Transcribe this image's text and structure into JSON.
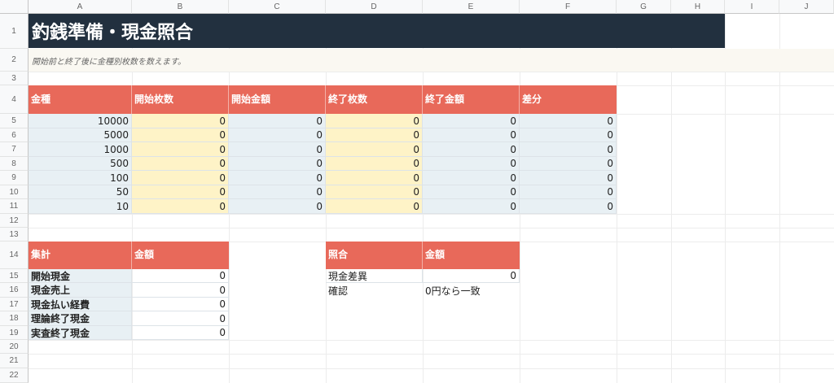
{
  "columns": [
    "A",
    "B",
    "C",
    "D",
    "E",
    "F",
    "G",
    "H",
    "I",
    "J"
  ],
  "rows": [
    "1",
    "2",
    "3",
    "4",
    "5",
    "6",
    "7",
    "8",
    "9",
    "10",
    "11",
    "12",
    "13",
    "14",
    "15",
    "16",
    "17",
    "18",
    "19",
    "20",
    "21",
    "22"
  ],
  "title": "釣銭準備・現金照合",
  "subtitle": "開始前と終了後に金種別枚数を数えます。",
  "denom_table": {
    "headers": [
      "金種",
      "開始枚数",
      "開始金額",
      "終了枚数",
      "終了金額",
      "差分"
    ],
    "rows": [
      [
        "10000",
        "0",
        "0",
        "0",
        "0",
        "0"
      ],
      [
        "5000",
        "0",
        "0",
        "0",
        "0",
        "0"
      ],
      [
        "1000",
        "0",
        "0",
        "0",
        "0",
        "0"
      ],
      [
        "500",
        "0",
        "0",
        "0",
        "0",
        "0"
      ],
      [
        "100",
        "0",
        "0",
        "0",
        "0",
        "0"
      ],
      [
        "50",
        "0",
        "0",
        "0",
        "0",
        "0"
      ],
      [
        "10",
        "0",
        "0",
        "0",
        "0",
        "0"
      ]
    ]
  },
  "summary_table": {
    "headers": [
      "集計",
      "金額"
    ],
    "rows": [
      [
        "開始現金",
        "0"
      ],
      [
        "現金売上",
        "0"
      ],
      [
        "現金払い経費",
        "0"
      ],
      [
        "理論終了現金",
        "0"
      ],
      [
        "実査終了現金",
        "0"
      ]
    ]
  },
  "check_table": {
    "headers": [
      "照合",
      "金額"
    ],
    "rows": [
      [
        "現金差異",
        "0"
      ],
      [
        "確認",
        "0円なら一致"
      ]
    ]
  },
  "colors": {
    "title_bg": "#22303f",
    "header_bg": "#e8695a",
    "input_bg": "#fef3c7",
    "label_bg": "#e8f0f4"
  }
}
